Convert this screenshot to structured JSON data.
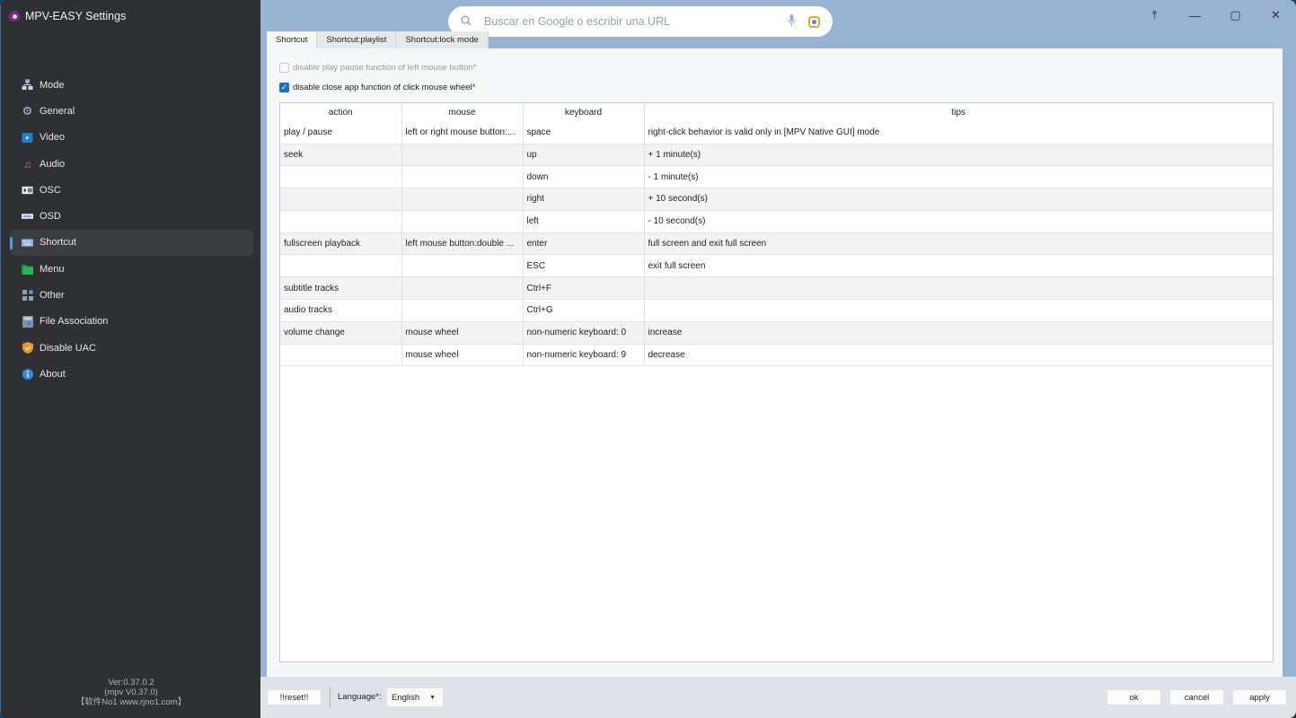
{
  "app": {
    "title": "MPV-EASY Settings"
  },
  "sidebar": {
    "items": [
      {
        "label": "Mode",
        "icon": "network-icon"
      },
      {
        "label": "General",
        "icon": "gear-icon"
      },
      {
        "label": "Video",
        "icon": "video-icon"
      },
      {
        "label": "Audio",
        "icon": "music-note-icon"
      },
      {
        "label": "OSC",
        "icon": "play-pause-icon"
      },
      {
        "label": "OSD",
        "icon": "display-bar-icon"
      },
      {
        "label": "Shortcut",
        "icon": "keyboard-icon",
        "active": true
      },
      {
        "label": "Menu",
        "icon": "folder-icon"
      },
      {
        "label": "Other",
        "icon": "grid-icon"
      },
      {
        "label": "File Association",
        "icon": "file-gear-icon"
      },
      {
        "label": "Disable UAC",
        "icon": "shield-icon"
      },
      {
        "label": "About",
        "icon": "info-icon"
      }
    ],
    "version": {
      "line1": "Ver:0.37.0.2",
      "line2": "(mpv V0.37.0)",
      "line3": "【软件No1 www.rjno1.com】"
    }
  },
  "browser_overlay": {
    "search_placeholder": "Buscar en Google o escribir una URL"
  },
  "window_controls": {
    "pin": "⤒",
    "minimize": "—",
    "maximize": "▢",
    "close": "✕"
  },
  "tabs": [
    {
      "label": "Shortcut",
      "active": true
    },
    {
      "label": "Shortcut:playlist"
    },
    {
      "label": "Shortcut:lock mode"
    }
  ],
  "options": {
    "disable_play_pause": {
      "label": "disable play pause function of left mouse button*",
      "checked": false,
      "disabled": true
    },
    "disable_close_wheel": {
      "label": "disable close app function of click mouse wheel*",
      "checked": true
    }
  },
  "table": {
    "columns": [
      "action",
      "mouse",
      "keyboard",
      "tips"
    ],
    "rows": [
      [
        "play / pause",
        "left or right mouse button:...",
        "space",
        "right-click behavior is valid only in [MPV Native GUI] mode"
      ],
      [
        "seek",
        "",
        "up",
        "+ 1 minute(s)"
      ],
      [
        "",
        "",
        "down",
        "- 1 minute(s)"
      ],
      [
        "",
        "",
        "right",
        "+ 10 second(s)"
      ],
      [
        "",
        "",
        "left",
        "- 10 second(s)"
      ],
      [
        "fullscreen playback",
        "left mouse button:double ...",
        "enter",
        "full screen and exit full screen"
      ],
      [
        "",
        "",
        "ESC",
        "exit full screen"
      ],
      [
        "subtitle tracks",
        "",
        "Ctrl+F",
        ""
      ],
      [
        "audio tracks",
        "",
        "Ctrl+G",
        ""
      ],
      [
        "volume change",
        "mouse wheel",
        "non-numeric keyboard: 0",
        "increase"
      ],
      [
        "",
        "mouse wheel",
        "non-numeric keyboard: 9",
        "decrease"
      ]
    ]
  },
  "footer": {
    "reset_label": "!!reset!!",
    "language_label": "Language*:",
    "language_value": "English",
    "ok_label": "ok",
    "cancel_label": "cancel",
    "apply_label": "apply"
  }
}
